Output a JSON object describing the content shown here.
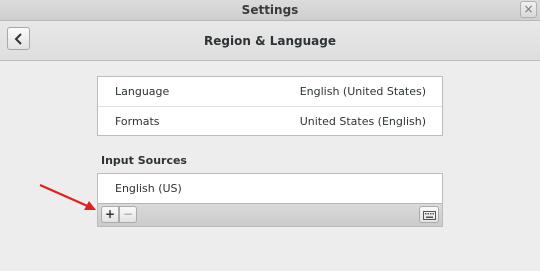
{
  "window": {
    "title": "Settings",
    "close_glyph": "×"
  },
  "header": {
    "title": "Region & Language",
    "back_icon": "chevron-left-icon"
  },
  "settings": {
    "language": {
      "label": "Language",
      "value": "English (United States)"
    },
    "formats": {
      "label": "Formats",
      "value": "United States (English)"
    }
  },
  "input_sources": {
    "heading": "Input Sources",
    "items": [
      "English (US)"
    ],
    "toolbar": {
      "add_glyph": "+",
      "remove_glyph": "−",
      "keyboard_icon": "keyboard-icon"
    }
  },
  "colors": {
    "annotation_arrow": "#e0201d"
  }
}
